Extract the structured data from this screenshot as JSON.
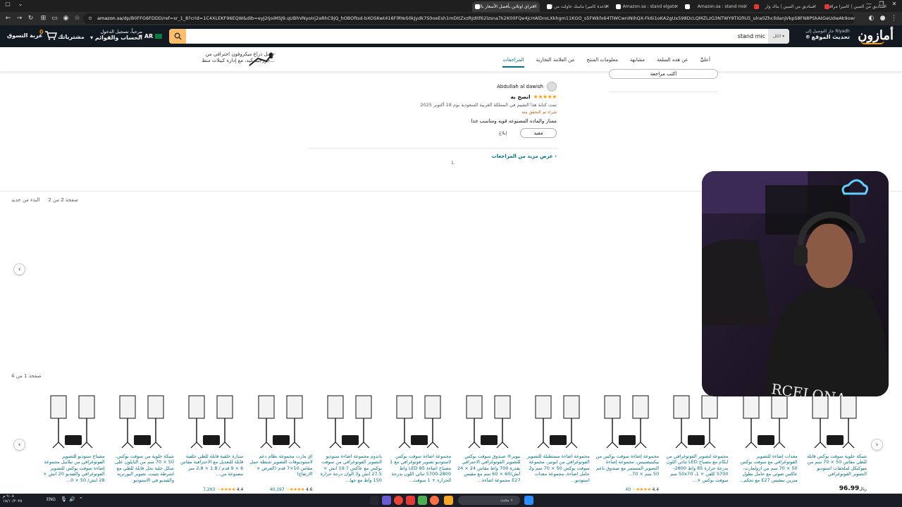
{
  "browser": {
    "tabs": [
      {
        "label": "صناديق من الصين | كاميرا مراقبة",
        "color": "#e53935"
      },
      {
        "label": "صناديق من الصين | ماك وار",
        "color": "#e53935"
      },
      {
        "label": "Amazon.sa : stand mic",
        "color": "#ffffff"
      },
      {
        "label": "Amazon.sa : stand elgato",
        "color": "#ffffff"
      },
      {
        "label": "قاعدة كاميرا ماسك حاولت من الـ",
        "color": "#ffffff"
      },
      {
        "label": "افتراي اوتلاين بأفضل الأسعار بالـ",
        "color": "#ffffff"
      }
    ],
    "url_site": "amazon.sa",
    "url_path": "/dp/B0FFG6FDDD/ref=sr_1_8?crid=1C4XLEKF96EQW&dib=eyJ2IjoiMSJ9.qUBhVNyoIrj2aRhC9jQ_hOBOftsd-bXOS6wt416FlRYeS0kJydk7S0oeEsh1mDItZxzRjdItf62lzsna7k2K00FQe4jcHAlDroLXkhgm11KGO_s5FWkfx64TlWCwnINihQX-Fk6i1oKA2gUx598DcLQMZLzG3NTWY9TiGfIU5_ulra0ZhclldanjVkpS8FN8PSkAtGeUdwAk9owfhtrRkNosR06BJTiqL-Z0haTqBTtr",
    "window_controls": [
      "—",
      "❐",
      "✕"
    ]
  },
  "header": {
    "logo": "أمازون",
    "deliver_line1": "جار التوصيل إلى Riyadh",
    "deliver_line2": "تحديث الموقع",
    "search_category": "الكل",
    "search_value": "stand mic",
    "lang": "AR",
    "account_line1": "مرحباً، تسجيل الدخول",
    "account_line2": "الحساب والقوائم",
    "orders": "مشترياتك",
    "cart_label": "عربة التسوق",
    "cart_count": "0"
  },
  "subnav": {
    "links": [
      {
        "label": "أعلى",
        "active": false
      },
      {
        "label": "عن هذه السلعة",
        "active": false
      },
      {
        "label": "مشابهة",
        "active": false
      },
      {
        "label": "معلومات المنتج",
        "active": false
      },
      {
        "label": "من العلامة التجارية",
        "active": false
      },
      {
        "label": "المراجعات",
        "active": true
      }
    ],
    "promo_line1": "حامل ذراع ميكروفون احترافي من",
    "promo_line2": "جورجيسكيد، مع إدارة كيبلات منظ..."
  },
  "review": {
    "write_review": "اكتب مراجعة",
    "reviewer": "Abdullah al dawish",
    "stars": 5,
    "title": "انصح به",
    "date": "تمت كتابة هذا التقييم في المملكة العربية السعودية يوم 18 أكتوبر 2025",
    "verified": "شراء تم التحقق منه",
    "body": "ممتاز والماده المصنوعه قويه ومناسب جدا",
    "helpful": "مفيد",
    "report": "إبلاغ",
    "more_reviews": "عرض مزيد من المراجعات ›",
    "loader": "1."
  },
  "pager1": {
    "page": "صفحة 2 من 2",
    "restart": "البدء من جديد"
  },
  "pager2": {
    "page": "صفحة 1 من 4"
  },
  "carousel": [
    {
      "title": "شبكة خلوية سوفت بوكس قابلة للطي مقاس 50 × 70 سم من ميوكيكل لملحقات استوديو التصوير الفوتوغرافي",
      "rating": "",
      "reviews": "",
      "price": "96.99",
      "currency": "ريال"
    },
    {
      "title": "معدات إضاءة للتصوير الفوتوغرافي مع سوفت بوكس 50 × 70 سم من ازولمارت، عاكس ضوئي مع حامل بطول مترين بمقبس E27 مع تحكم...",
      "rating": "",
      "reviews": "",
      "price": "",
      "currency": ""
    },
    {
      "title": "مجموعة لتصوير الفوتوغرافي من ايكام مع مصباح LED ثنائي اللون بدرجة حرارة 85 واط 2800-5700 كلفن × 1، 50x70 سم سوفت بوكس ×...",
      "rating": "",
      "reviews": "",
      "price": "",
      "currency": ""
    },
    {
      "title": "مجموعة إضاءة سوفت بوكس من بيكينيضبيس، مجموعة إضاءة التصوير المستمر مع صندوق ناعم 50 سم × 70...",
      "rating": "4.4",
      "reviews": "40",
      "price": "",
      "currency": ""
    },
    {
      "title": "مجموعة اضاءة مستطيلة للتصوير الفوتوغرافي من ايونير، مجموعة سوفت بوكس 50 × 70 سم و2 حامل اضاءة، مجموعة معدات استوديو...",
      "rating": "",
      "reviews": "",
      "price": "",
      "currency": ""
    },
    {
      "title": "نيوير® صندوق سوفت بوكس للتصوير الفوتوغرافي الاحترافي بقدرة 700 واط مقاس 24 × 24 انش/60 × 60 سم مع مقبس E27 مجموعة اضاءة...",
      "rating": "",
      "reviews": "",
      "price": "",
      "currency": ""
    },
    {
      "title": "مجموعة اضاءة سوفت بوكس لاستوديو تصوير فوتوغرافي مع 1 مصباح اضاءة LED 85 واط 2800-5700 ثنائي اللون بدرجة الحرارة + 1 سوفت...",
      "rating": "",
      "reviews": "",
      "price": "",
      "currency": ""
    },
    {
      "title": "باندوم مجموعة اضاءة ستوديو التصوير الفوتوغرافي من سوفت بوكس مع عاكس 19.7 انش × 27.5 انش و3 الوان درجة حرارة 150 واط مع جها...",
      "rating": "",
      "reviews": "",
      "price": "",
      "currency": ""
    },
    {
      "title": "اي مارت مجموعة نظام دعم لاستوديوهات التصوير شنطة حمل مقاس 10×7 قدم (العرض × الارتفاع)",
      "rating": "4.6",
      "reviews": "40,197",
      "price": "",
      "currency": ""
    },
    {
      "title": "ستارة خلفية قابلة للطي خلفية قابلة للتعديل مع الاحترافية مقاس 6 × 9 قدم / 1.8 × 2.8 متر مصنوعة من...",
      "rating": "4.4",
      "reviews": "7,293",
      "price": "",
      "currency": ""
    },
    {
      "title": "شبكة خلوية من سوفت بوكس، 50 × 70 سم من النايلون على شكل خلية نحل قابلة للطي مع اشرطة تثبيت، تصوير البورتريه والفيديو في الاستوديو",
      "rating": "",
      "reviews": "",
      "price": "",
      "currency": ""
    },
    {
      "title": "مصباح ستوديو للتصوير الفوتوغرافي من نيلايبل مجموعة إضاءة سوفت بوكس للتصوير الفوتوغرافي والفيديو 20 انش × 28 انش/ 50 × 0...",
      "rating": "",
      "reviews": "",
      "price": "",
      "currency": ""
    }
  ],
  "taskbar": {
    "search": "بحث",
    "lang": "ENG",
    "time": "٩:٠٨ م",
    "date": "١٨/١٠/٢٠٢٥"
  }
}
